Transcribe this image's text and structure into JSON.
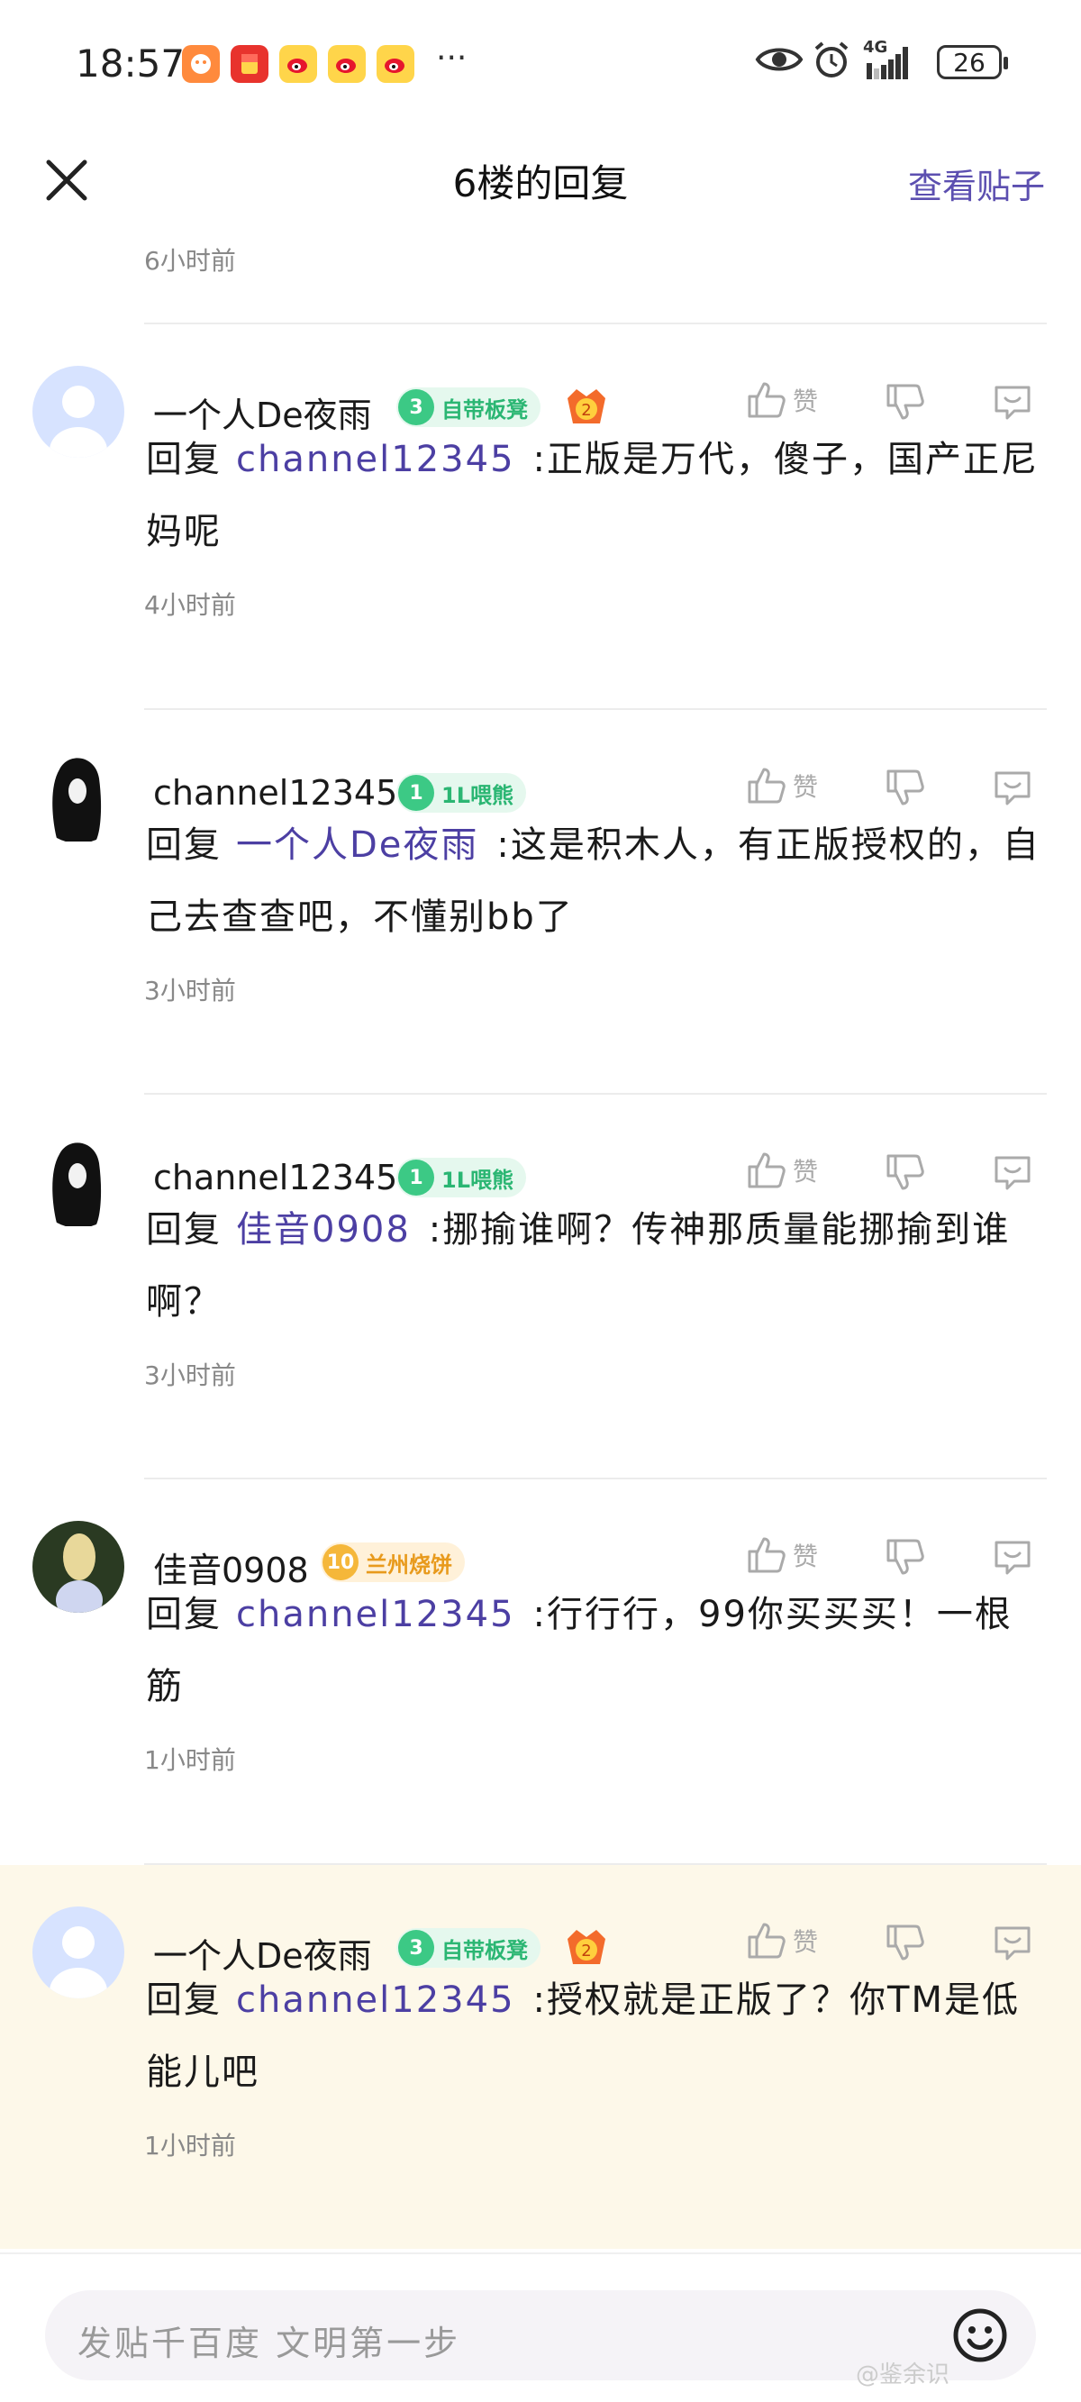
{
  "status": {
    "time": "18:57",
    "more": "···",
    "battery": "26",
    "network": "4G"
  },
  "nav": {
    "title": "6楼的回复",
    "view_post": "查看贴子"
  },
  "first_time": "6小时前",
  "like_label": "赞",
  "reply_prefix": "回复",
  "comments": [
    {
      "user": "一个人De夜雨",
      "level": "3",
      "badge": "自带板凳",
      "medal": "2",
      "mention": "channel12345",
      "text": ":正版是万代，傻子，国产正尼妈呢",
      "time": "4小时前"
    },
    {
      "user": "channel12345",
      "level": "1",
      "badge": "1L喂熊",
      "mention": "一个人De夜雨",
      "text": ":这是积木人，有正版授权的，自己去查查吧，不懂别bb了",
      "time": "3小时前"
    },
    {
      "user": "channel12345",
      "level": "1",
      "badge": "1L喂熊",
      "mention": "佳音0908",
      "text": ":挪揄谁啊？传神那质量能挪揄到谁啊？",
      "time": "3小时前"
    },
    {
      "user": "佳音0908",
      "level": "10",
      "badge": "兰州烧饼",
      "mention": "channel12345",
      "text": ":行行行，99你买买买！一根筋",
      "time": "1小时前"
    },
    {
      "user": "一个人De夜雨",
      "level": "3",
      "badge": "自带板凳",
      "medal": "2",
      "mention": "channel12345",
      "text": ":授权就是正版了？你TM是低能儿吧",
      "time": "1小时前"
    }
  ],
  "input": {
    "placeholder": "发贴千百度 文明第一步"
  },
  "watermark": "@鉴余识"
}
